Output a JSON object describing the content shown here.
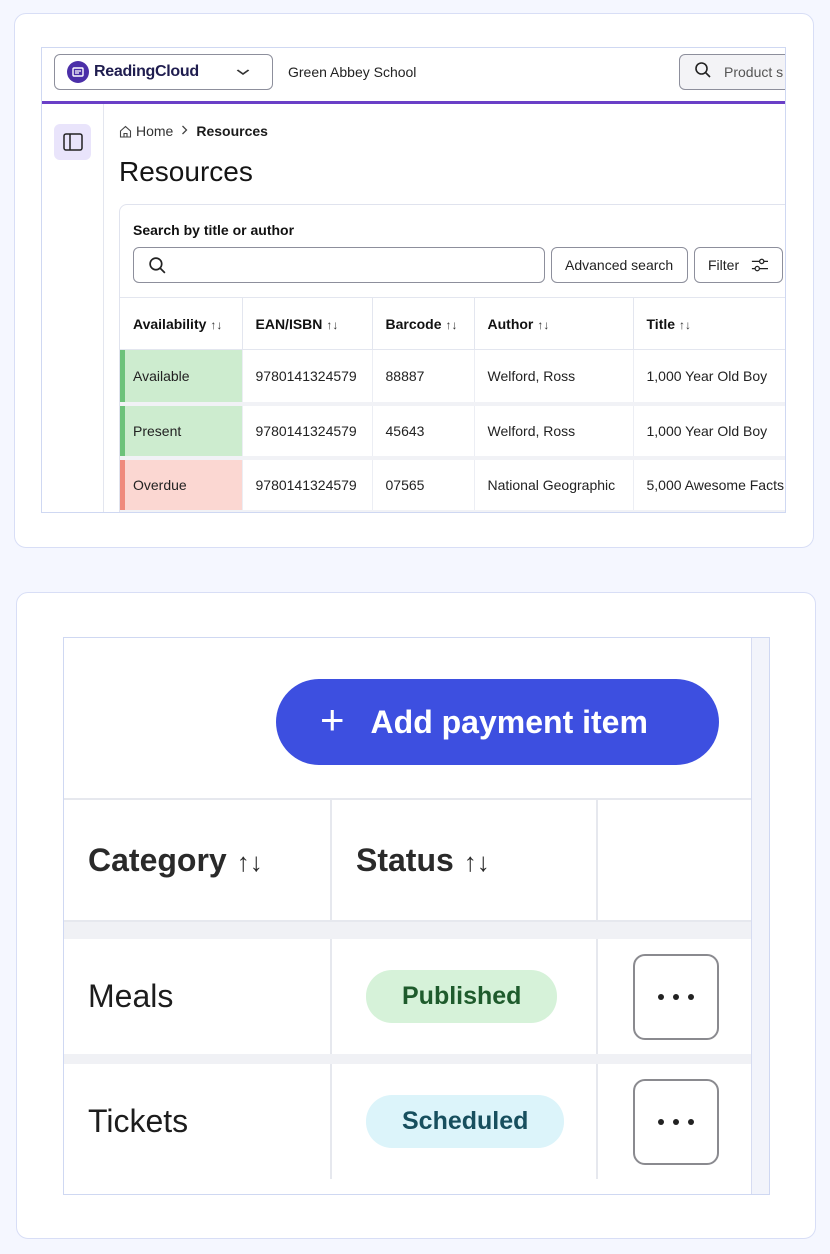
{
  "resources_view": {
    "logo": {
      "icon": "readingcloud-logo-icon",
      "text": "ReadingCloud"
    },
    "school": "Green Abbey School",
    "product_search": {
      "placeholder": "Product s"
    },
    "breadcrumb": {
      "home": "Home",
      "current": "Resources"
    },
    "page_title": "Resources",
    "search": {
      "label": "Search by title or author",
      "value": "",
      "advanced_label": "Advanced search",
      "filter_label": "Filter"
    },
    "columns": [
      {
        "label": "Availability",
        "sort": "↑↓"
      },
      {
        "label": "EAN/ISBN",
        "sort": "↑↓"
      },
      {
        "label": "Barcode",
        "sort": "↑↓"
      },
      {
        "label": "Author",
        "sort": "↑↓"
      },
      {
        "label": "Title",
        "sort": "↑↓"
      }
    ],
    "rows": [
      {
        "availability": "Available",
        "isbn": "9780141324579",
        "barcode": "88887",
        "author": "Welford, Ross",
        "title": "1,000 Year Old Boy"
      },
      {
        "availability": "Present",
        "isbn": "9780141324579",
        "barcode": "45643",
        "author": "Welford, Ross",
        "title": "1,000 Year Old Boy"
      },
      {
        "availability": "Overdue",
        "isbn": "9780141324579",
        "barcode": "07565",
        "author": "National Geographic",
        "title": "5,000 Awesome Facts"
      }
    ],
    "colors": {
      "accent": "#6a3fc7",
      "available": "#cdeccf",
      "overdue": "#fbd7d2"
    }
  },
  "payments_view": {
    "add_button": {
      "icon": "plus-icon",
      "label": "Add payment item"
    },
    "columns": [
      {
        "label": "Category",
        "sort": "↑↓"
      },
      {
        "label": "Status",
        "sort": "↑↓"
      }
    ],
    "rows": [
      {
        "category": "Meals",
        "status": "Published"
      },
      {
        "category": "Tickets",
        "status": "Scheduled"
      }
    ],
    "colors": {
      "button": "#3d4fe0",
      "published": "#d6f2d9",
      "scheduled": "#dcf4fa"
    }
  }
}
